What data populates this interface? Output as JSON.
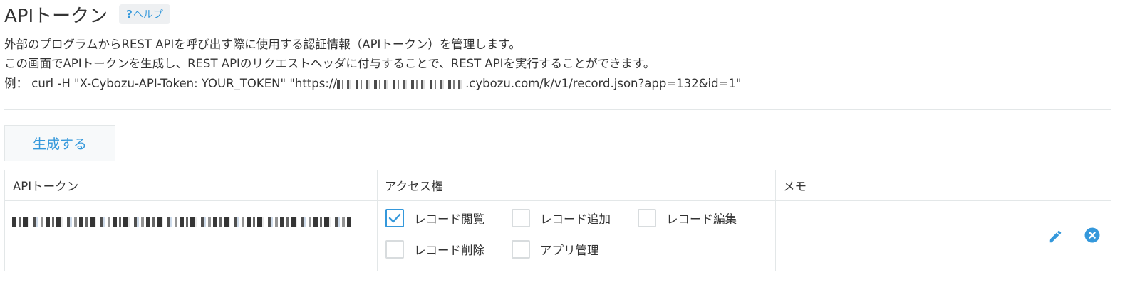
{
  "page": {
    "title": "APIトークン",
    "help_mark": "?",
    "help_label": "ヘルプ"
  },
  "description": {
    "line1": "外部のプログラムからREST APIを呼び出す際に使用する認証情報（APIトークン）を管理します。",
    "line2": "この画面でAPIトークンを生成し、REST APIのリクエストヘッダに付与することで、REST APIを実行することができます。",
    "line3_prefix": "例：  curl -H \"X-Cybozu-API-Token: YOUR_TOKEN\" \"https://",
    "line3_suffix": ".cybozu.com/k/v1/record.json?app=132&id=1\""
  },
  "generate_button": {
    "label": "生成する"
  },
  "table": {
    "headers": {
      "token": "APIトークン",
      "access": "アクセス権",
      "memo": "メモ"
    },
    "rows": [
      {
        "token_masked": true,
        "permissions": [
          {
            "label": "レコード閲覧",
            "checked": true
          },
          {
            "label": "レコード追加",
            "checked": false
          },
          {
            "label": "レコード編集",
            "checked": false
          },
          {
            "label": "レコード削除",
            "checked": false
          },
          {
            "label": "アプリ管理",
            "checked": false
          }
        ],
        "memo": ""
      }
    ]
  },
  "icons": {
    "help": "question-mark",
    "edit": "pencil-icon",
    "delete": "close-circle-icon",
    "checkbox_checked": "checkmark-icon"
  },
  "colors": {
    "accent": "#3498db",
    "text": "#333333",
    "border": "#e3e7e8",
    "button_bg": "#f7f9fa"
  }
}
